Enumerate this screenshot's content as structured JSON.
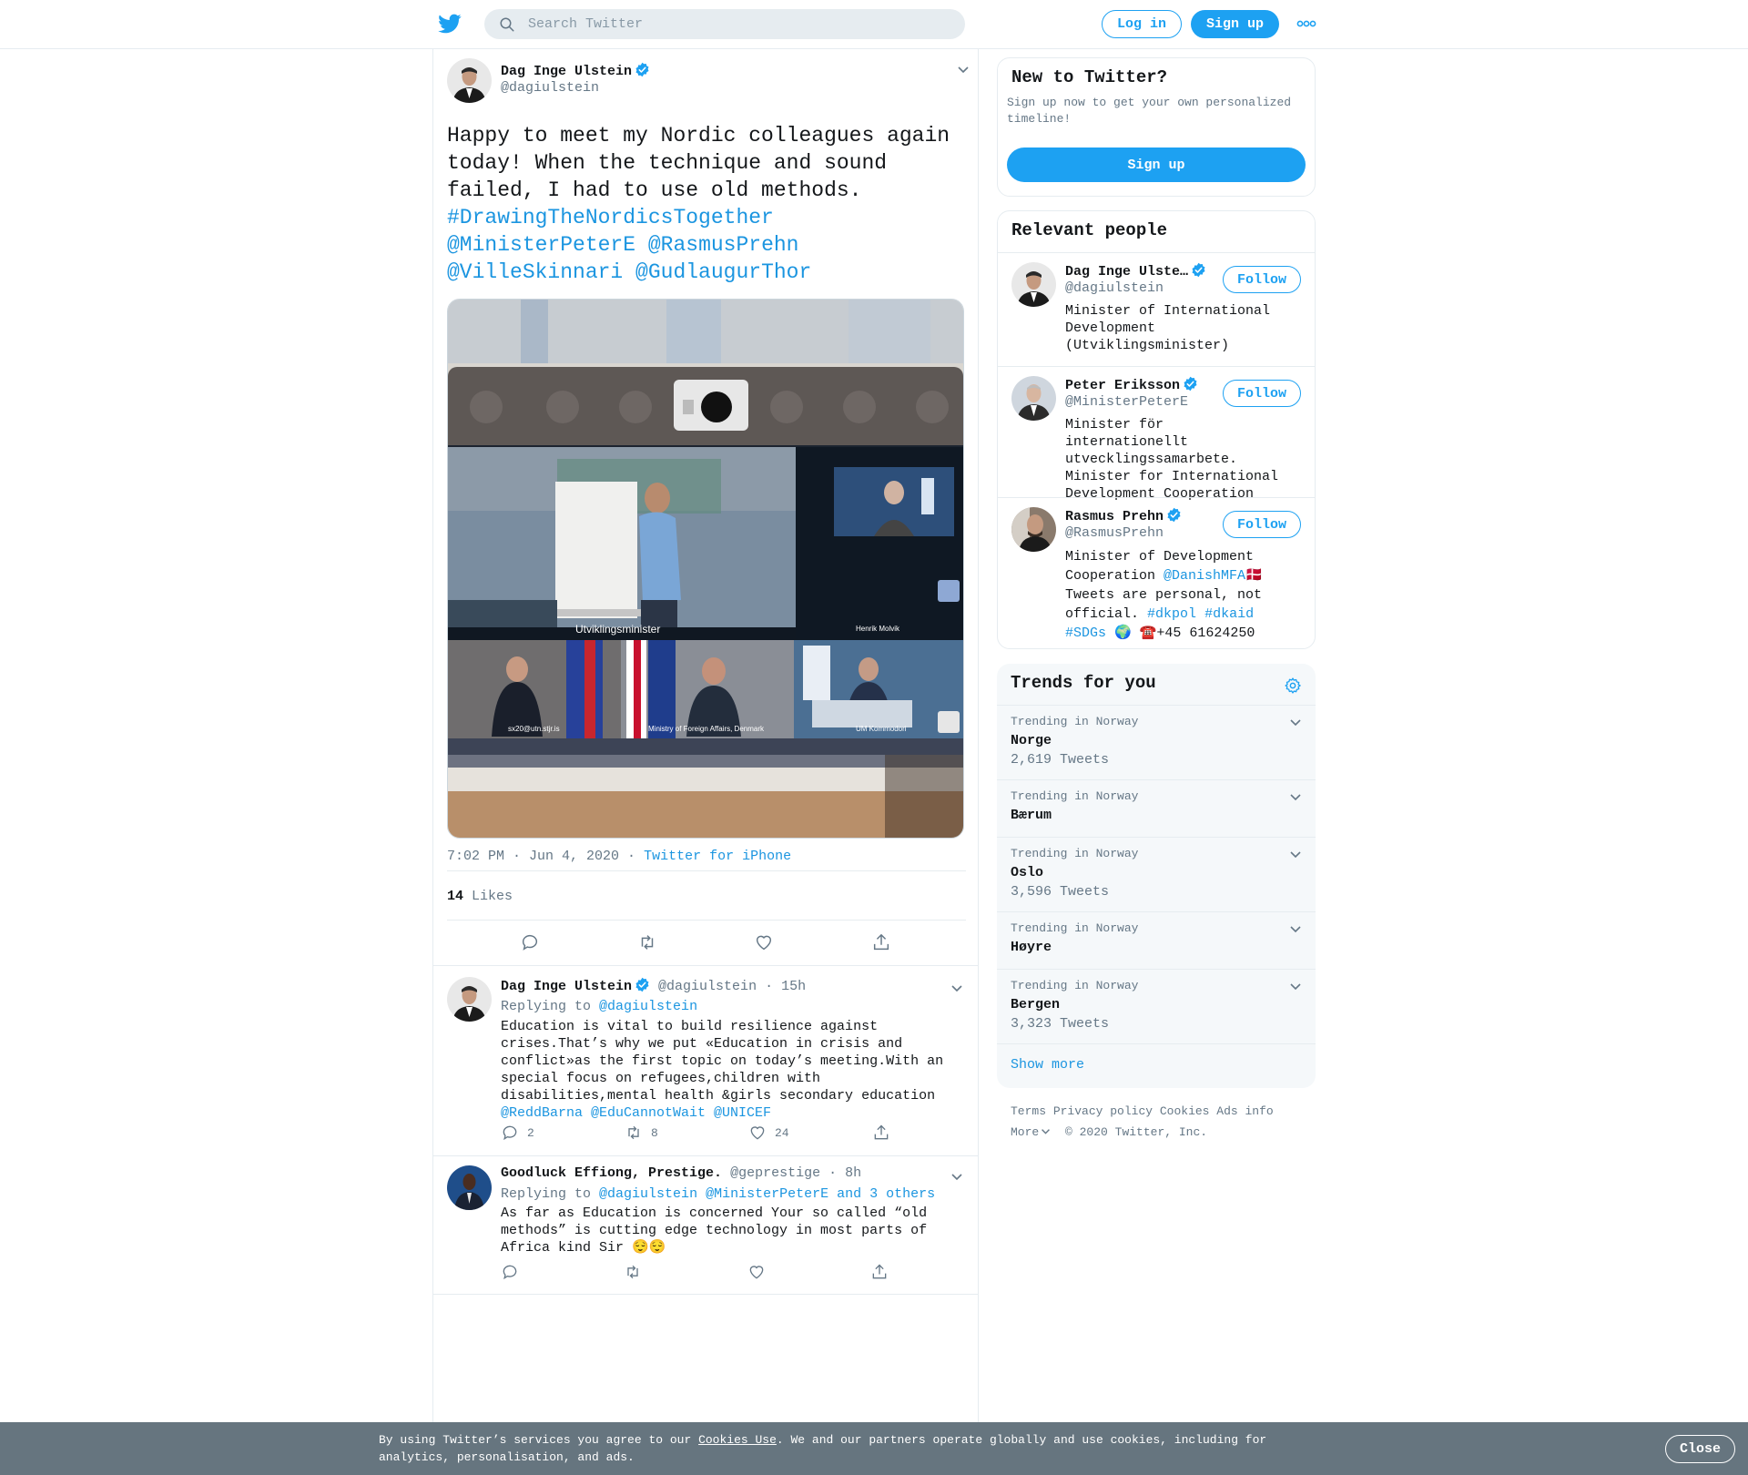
{
  "header": {
    "search_placeholder": "Search Twitter",
    "login_label": "Log in",
    "signup_label": "Sign up",
    "brand_color": "#1da1f2"
  },
  "main_tweet": {
    "name": "Dag Inge Ulstein",
    "handle": "@dagiulstein",
    "text_plain": "Happy to meet my Nordic colleagues again today! When the technique and sound failed, I had to use old methods.",
    "hashtag": "#DrawingTheNordicsTogether",
    "mention_1": "@MinisterPeterE",
    "mention_2": "@RasmusPrehn",
    "mention_3": "@VilleSkinnari",
    "mention_4": "@GudlaugurThor",
    "time": "7:02 PM · Jun 4, 2020",
    "sep": "·",
    "source": "Twitter for iPhone",
    "likes_count": "14",
    "likes_label": "Likes",
    "photo_labels": {
      "main": "Utviklingsminister",
      "top_right": "Henrik Molvik",
      "bottom_left": "sx20@utn.stjr.is",
      "bottom_mid": "Ministry of Foreign Affairs, Denmark",
      "bottom_right": "UM Kommodori"
    }
  },
  "replies": [
    {
      "name": "Dag Inge Ulstein",
      "handle": "@dagiulstein",
      "time": "· 15h",
      "replying_label": "Replying to",
      "replying_to": "@dagiulstein",
      "replying_extra": "",
      "text": "Education is vital to build resilience against crises.That’s why we put «Education in crisis and conflict»as the first topic on today’s meeting.With an special focus on refugees,children with disabilities,mental health &girls secondary education",
      "mentions": "@ReddBarna @EduCannotWait @UNICEF",
      "replies_count": "2",
      "retweets_count": "8",
      "likes_count": "24"
    },
    {
      "name": "Goodluck Effiong, Prestige.",
      "handle": "@geprestige",
      "time": "· 8h",
      "replying_label": "Replying to",
      "replying_to": "@dagiulstein @MinisterPeterE",
      "replying_extra": "and 3 others",
      "text": "As far as Education is concerned Your so called “old methods” is cutting edge technology in most parts of Africa kind Sir 😌😌",
      "mentions": "",
      "replies_count": "",
      "retweets_count": "",
      "likes_count": ""
    }
  ],
  "sidebar": {
    "new_to_twitter": {
      "title": "New to Twitter?",
      "subtitle": "Sign up now to get your own personalized timeline!",
      "button": "Sign up"
    },
    "relevant_people": {
      "title": "Relevant people",
      "follow_label": "Follow",
      "people": [
        {
          "name": "Dag Inge Ulste…",
          "handle": "@dagiulstein",
          "bio": "Minister of International Development (Utviklingsminister)"
        },
        {
          "name": "Peter Eriksson",
          "handle": "@MinisterPeterE",
          "bio": "Minister för internationellt utvecklingssamarbete. Minister for International Development Cooperation"
        },
        {
          "name": "Rasmus Prehn",
          "handle": "@RasmusPrehn",
          "bio_1": "Minister of Development Cooperation",
          "bio_mention": "@DanishMFA",
          "bio_flag": "🇩🇰",
          "bio_2": "Tweets are personal, not official.",
          "bio_tag_1": "#dkpol",
          "bio_tag_2": "#dkaid",
          "bio_tag_3": "#SDGs",
          "bio_3": "🌍 ☎️+45 61624250"
        }
      ]
    },
    "trends": {
      "title": "Trends for you",
      "items": [
        {
          "context": "Trending in Norway",
          "name": "Norge",
          "count": "2,619 Tweets"
        },
        {
          "context": "Trending in Norway",
          "name": "Bærum",
          "count": ""
        },
        {
          "context": "Trending in Norway",
          "name": "Oslo",
          "count": "3,596 Tweets"
        },
        {
          "context": "Trending in Norway",
          "name": "Høyre",
          "count": ""
        },
        {
          "context": "Trending in Norway",
          "name": "Bergen",
          "count": "3,323 Tweets"
        }
      ],
      "show_more": "Show more"
    },
    "footer": {
      "links": [
        "Terms",
        "Privacy policy",
        "Cookies",
        "Ads info"
      ],
      "more": "More",
      "copyright": "© 2020 Twitter, Inc."
    }
  },
  "cookie_banner": {
    "text_before": "By using Twitter’s services you agree to our",
    "link": "Cookies Use",
    "text_after": ". We and our partners operate globally and use cookies, including for analytics, personalisation, and ads.",
    "close": "Close"
  }
}
